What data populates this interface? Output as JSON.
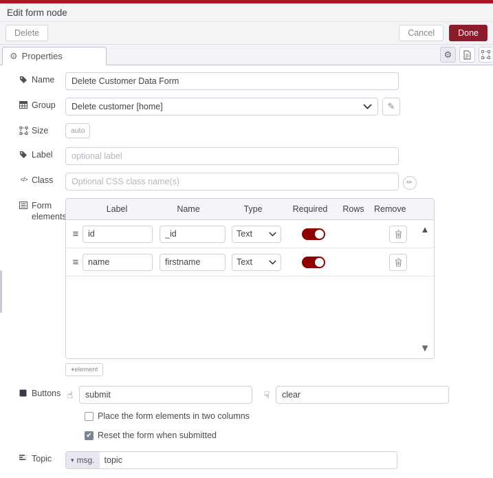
{
  "dialog": {
    "title": "Edit form node",
    "toolbar": {
      "delete_label": "Delete",
      "cancel_label": "Cancel",
      "done_label": "Done"
    },
    "tab": {
      "label": "Properties"
    }
  },
  "icons": {
    "gear": "⚙",
    "drag_handle": "≡",
    "pencil": "✎",
    "scroll_up": "▲",
    "scroll_down": "▼",
    "caret_down": "▾",
    "plus": "+",
    "check": "✔",
    "thumb_up": "☝",
    "thumb_down": "☟",
    "code": "</>"
  },
  "fields": {
    "name": {
      "label": "Name",
      "value": "Delete Customer Data Form"
    },
    "group": {
      "label": "Group",
      "value": "Delete customer [home]"
    },
    "size": {
      "label": "Size",
      "value": "auto"
    },
    "node_label": {
      "label": "Label",
      "placeholder": "optional label"
    },
    "css_class": {
      "label": "Class",
      "placeholder": "Optional CSS class name(s)"
    },
    "form_elements": {
      "label": "Form elements",
      "columns": {
        "label": "Label",
        "name": "Name",
        "type": "Type",
        "required": "Required",
        "rows": "Rows",
        "remove": "Remove"
      },
      "rows": [
        {
          "label": "id",
          "name": "_id",
          "type": "Text",
          "required": true
        },
        {
          "label": "name",
          "name": "firstname",
          "type": "Text",
          "required": true
        }
      ],
      "add_button_label": "element"
    },
    "buttons": {
      "label": "Buttons",
      "submit_value": "submit",
      "clear_value": "clear"
    },
    "two_columns": {
      "label": "Place the form elements in two columns",
      "checked": false
    },
    "reset": {
      "label": "Reset the form when submitted",
      "checked": true,
      "checked_attr": "checked"
    },
    "topic": {
      "label": "Topic",
      "prefix": "msg.",
      "value": "topic"
    }
  },
  "colors": {
    "accent_red": "#ad1625",
    "done_button": "#8c1b2b",
    "toggle_on": "#8e0000",
    "header_bg": "#f4f4f7"
  }
}
